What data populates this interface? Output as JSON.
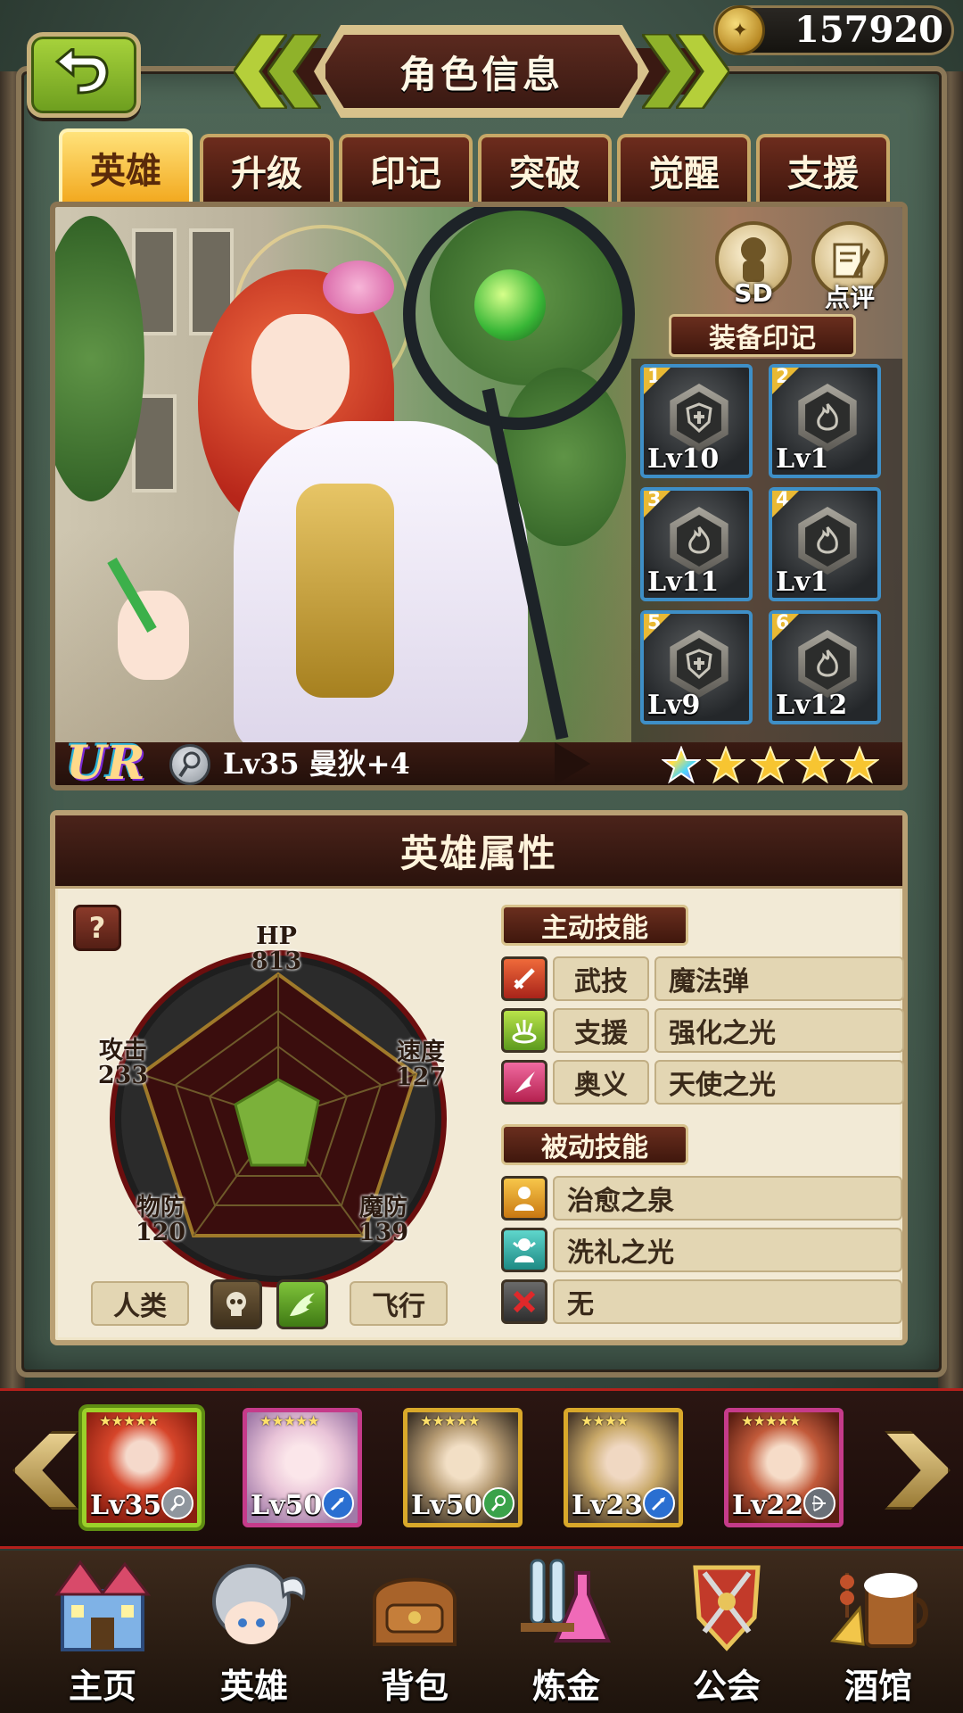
{
  "header": {
    "title": "角色信息",
    "gold": "157920",
    "back_icon": "back-arrow-icon",
    "coin_icon": "gold-coin-icon"
  },
  "tabs": [
    {
      "label": "英雄",
      "active": true
    },
    {
      "label": "升级",
      "active": false
    },
    {
      "label": "印记",
      "active": false
    },
    {
      "label": "突破",
      "active": false
    },
    {
      "label": "觉醒",
      "active": false
    },
    {
      "label": "支援",
      "active": false
    }
  ],
  "portrait": {
    "sd_label": "SD",
    "rate_label": "点评",
    "equip_title": "装备印记",
    "marks": [
      {
        "slot": "1",
        "level": "Lv10",
        "icon": "shield-mark-icon"
      },
      {
        "slot": "2",
        "level": "Lv1",
        "icon": "flame-mark-icon"
      },
      {
        "slot": "3",
        "level": "Lv11",
        "icon": "flame-mark-icon"
      },
      {
        "slot": "4",
        "level": "Lv1",
        "icon": "flame-mark-icon"
      },
      {
        "slot": "5",
        "level": "Lv9",
        "icon": "shield-mark-icon"
      },
      {
        "slot": "6",
        "level": "Lv12",
        "icon": "flame-mark-icon"
      }
    ],
    "rarity": "UR",
    "class_icon": "staff-class-icon",
    "name_line": "Lv35 曼狄+4",
    "stars": 5,
    "star_colors": [
      "rainbow",
      "gold",
      "gold",
      "gold",
      "gold"
    ]
  },
  "attributes": {
    "title": "英雄属性",
    "help": "?",
    "stats": {
      "hp": {
        "label": "HP",
        "value": "813"
      },
      "speed": {
        "label": "速度",
        "value": "127"
      },
      "mdef": {
        "label": "魔防",
        "value": "139"
      },
      "pdef": {
        "label": "物防",
        "value": "120"
      },
      "atk": {
        "label": "攻击",
        "value": "233"
      }
    },
    "traits": {
      "race": "人类",
      "race_icon": "skull-icon",
      "element_icon": "wing-icon",
      "movement": "飞行"
    },
    "active_title": "主动技能",
    "active_skills": [
      {
        "type": "武技",
        "name": "魔法弹",
        "icon": "sword-icon",
        "color": "#d8432a"
      },
      {
        "type": "支援",
        "name": "强化之光",
        "icon": "support-light-icon",
        "color": "#8cc63f"
      },
      {
        "type": "奥义",
        "name": "天使之光",
        "icon": "ultimate-icon",
        "color": "#e0457b"
      }
    ],
    "passive_title": "被动技能",
    "passive_skills": [
      {
        "name": "治愈之泉",
        "icon": "healing-spring-icon",
        "color": "#f0a020"
      },
      {
        "name": "洗礼之光",
        "icon": "baptism-light-icon",
        "color": "#35b0a8"
      },
      {
        "name": "无",
        "icon": "none-x-icon",
        "color": "#4a4a4a"
      }
    ]
  },
  "roster": [
    {
      "level": "Lv35",
      "element_icon": "staff-class-icon",
      "selected": true
    },
    {
      "level": "Lv50",
      "element_icon": "spear-class-icon",
      "selected": false
    },
    {
      "level": "Lv50",
      "element_icon": "staff-class-icon",
      "selected": false
    },
    {
      "level": "Lv23",
      "element_icon": "spear-class-icon",
      "selected": false
    },
    {
      "level": "Lv22",
      "element_icon": "bow-class-icon",
      "selected": false
    }
  ],
  "nav": [
    {
      "label": "主页",
      "icon": "castle-icon"
    },
    {
      "label": "英雄",
      "icon": "knight-helmet-icon"
    },
    {
      "label": "背包",
      "icon": "backpack-icon"
    },
    {
      "label": "炼金",
      "icon": "potion-flask-icon"
    },
    {
      "label": "公会",
      "icon": "guild-crest-icon"
    },
    {
      "label": "酒馆",
      "icon": "tavern-icon"
    }
  ]
}
